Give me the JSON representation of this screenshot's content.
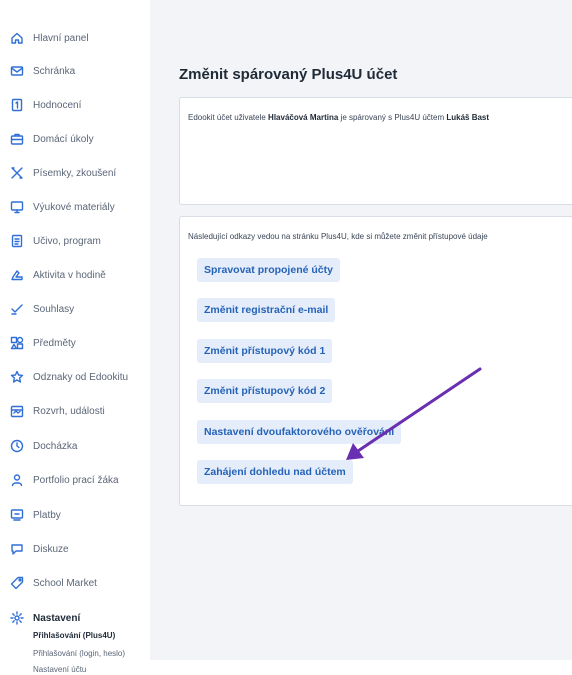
{
  "sidebar": {
    "items": [
      {
        "label": "Hlavní panel",
        "icon": "home-icon"
      },
      {
        "label": "Schránka",
        "icon": "mail-icon"
      },
      {
        "label": "Hodnocení",
        "icon": "grades-icon"
      },
      {
        "label": "Domácí úkoly",
        "icon": "briefcase-icon"
      },
      {
        "label": "Písemky, zkoušení",
        "icon": "tools-icon"
      },
      {
        "label": "Výukové materiály",
        "icon": "monitor-icon"
      },
      {
        "label": "Učivo, program",
        "icon": "book-icon"
      },
      {
        "label": "Aktivita v hodině",
        "icon": "hand-icon"
      },
      {
        "label": "Souhlasy",
        "icon": "check-icon"
      },
      {
        "label": "Předměty",
        "icon": "subjects-icon"
      },
      {
        "label": "Odznaky od Edookitu",
        "icon": "star-icon"
      },
      {
        "label": "Rozvrh, události",
        "icon": "calendar-icon"
      },
      {
        "label": "Docházka",
        "icon": "clock-icon"
      },
      {
        "label": "Portfolio prací žáka",
        "icon": "person-icon"
      },
      {
        "label": "Platby",
        "icon": "payment-icon"
      },
      {
        "label": "Diskuze",
        "icon": "chat-icon"
      },
      {
        "label": "School Market",
        "icon": "tag-icon"
      },
      {
        "label": "Nastavení",
        "icon": "gear-icon"
      }
    ],
    "active_item": "Nastavení",
    "subitems": [
      {
        "label": "Přihlašování (Plus4U)"
      },
      {
        "label": "Přihlašování (login, heslo)"
      },
      {
        "label": "Nastavení účtu"
      }
    ]
  },
  "main": {
    "title": "Změnit spárovaný Plus4U účet",
    "pairing": {
      "prefix": "Edookit účet uživatele ",
      "user": "Hlaváčová Martina",
      "middle": " je spárovaný s Plus4U účtem ",
      "account": "Lukáš Bast"
    },
    "links_intro": "Následující odkazy vedou na stránku Plus4U, kde si můžete změnit přístupové údaje",
    "links": [
      {
        "label": "Spravovat propojené účty"
      },
      {
        "label": "Změnit registrační e-mail"
      },
      {
        "label": "Změnit přístupový kód 1"
      },
      {
        "label": "Změnit přístupový kód 2"
      },
      {
        "label": "Nastavení dvoufaktorového ověřování"
      },
      {
        "label": "Zahájení dohledu nad účtem"
      }
    ]
  },
  "colors": {
    "accent": "#2f6fd6",
    "link_bg": "#e5edfa",
    "link_text": "#2563b8",
    "page_bg": "#f2f4f7",
    "annotation_arrow": "#6a2fb0"
  }
}
